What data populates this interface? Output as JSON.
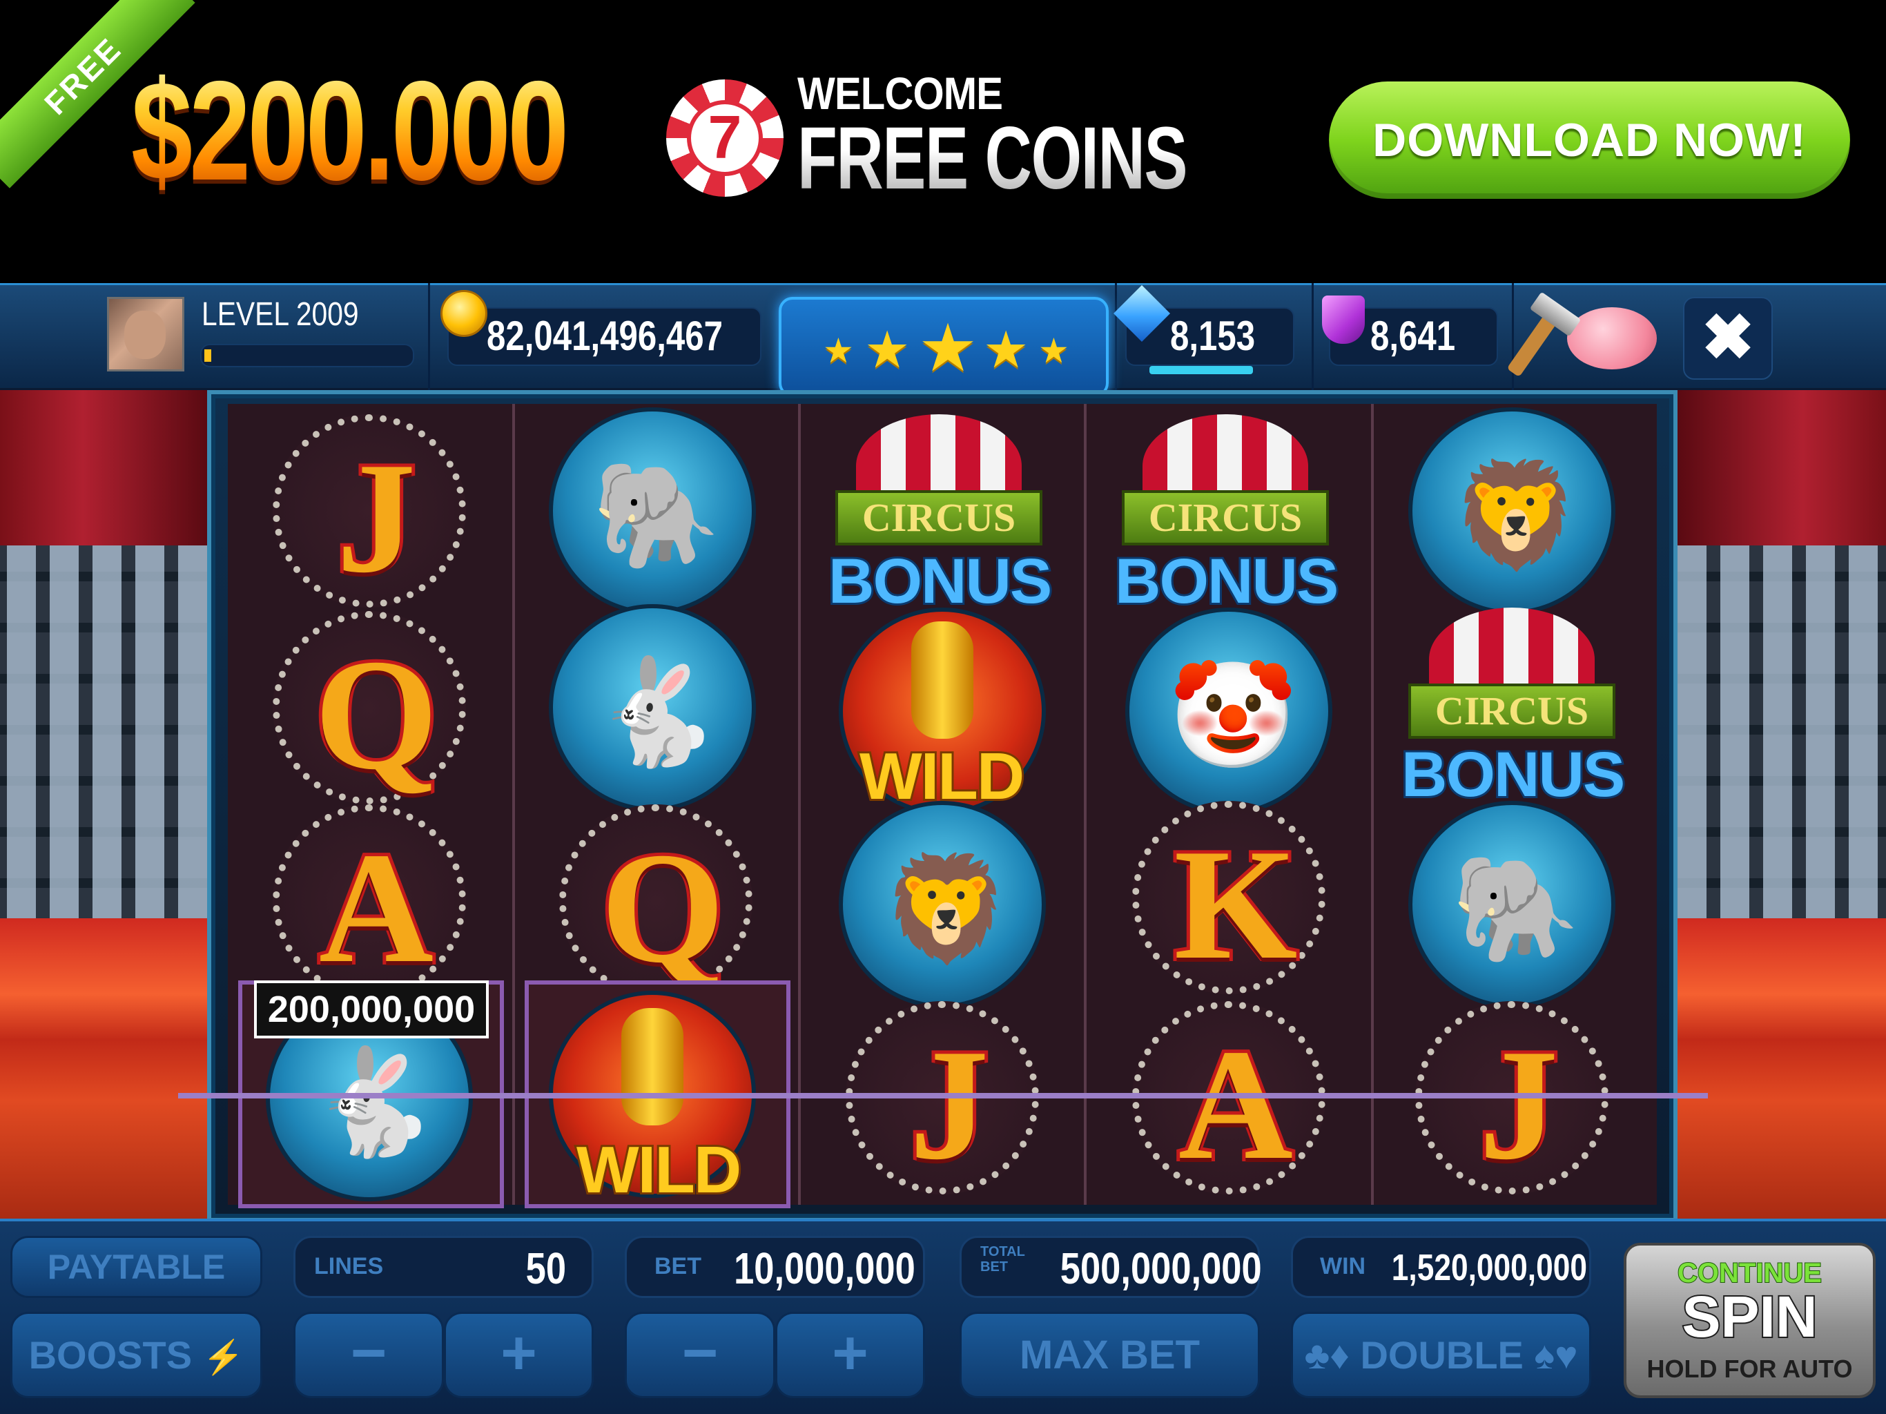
{
  "banner": {
    "ribbon": "FREE",
    "amount": "$200.000",
    "chip_number": "7",
    "welcome": "WELCOME",
    "free_coins": "FREE COINS",
    "download": "DOWNLOAD NOW!"
  },
  "hud": {
    "level": "LEVEL 2009",
    "level_progress": 0.03,
    "coins": "82,041,496,467",
    "stars": 5,
    "gems": "8,153",
    "shields": "8,641",
    "close": "✖",
    "icons": [
      "avatar",
      "coin-icon",
      "diamond-icon",
      "shield-icon",
      "hammer-icon",
      "piggy-bank-icon",
      "close-icon"
    ]
  },
  "reels": {
    "letters": {
      "r1c1": "J",
      "r2c1": "Q",
      "r3c1": "A",
      "r3c2": "Q",
      "r3c4": "K",
      "r4c3": "J",
      "r4c4": "A",
      "r4c5": "J"
    },
    "circus": "CIRCUS",
    "bonus": "BONUS",
    "wild": "WILD",
    "win_amount": "200,000,000"
  },
  "controls": {
    "paytable": "PAYTABLE",
    "boosts": "BOOSTS",
    "lines_label": "LINES",
    "lines_value": "50",
    "bet_label": "BET",
    "bet_value": "10,000,000",
    "total_bet_label": "TOTAL BET",
    "total_bet_value": "500,000,000",
    "win_label": "WIN",
    "win_value": "1,520,000,000",
    "minus": "−",
    "plus": "+",
    "max_bet": "MAX BET",
    "double": "DOUBLE",
    "spin_top": "CONTINUE",
    "spin_main": "SPIN",
    "spin_sub": "HOLD FOR AUTO"
  },
  "colors": {
    "accent_blue": "#2a7fc6",
    "download_green": "#7fd41d",
    "promo_gold": "#ffb319",
    "payline_purple": "#9b7fc7"
  }
}
